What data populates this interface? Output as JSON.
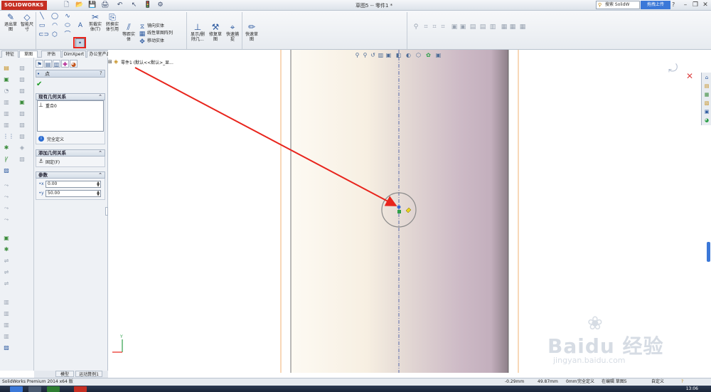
{
  "window": {
    "app_logo": "SOLIDWORKS",
    "doc_title": "草图5 -- 零件1 *",
    "search_label": "搜索 SolidW",
    "upload_label": "拖拽上传",
    "help_label": "?",
    "min_label": "–",
    "restore_label": "❐",
    "close_label": "✕"
  },
  "quick_access": [
    "🗋",
    "📂",
    "💾",
    "🖨",
    "↶",
    "↖",
    "🚦",
    "⚙"
  ],
  "command_manager": {
    "exit_sketch": "退出草\n图",
    "smart_dim": "智能尺\n寸",
    "trim": "剪裁实\n体(T)",
    "convert": "转换实\n体引用",
    "offset": "等距实\n体",
    "mirror": "镜向实体",
    "linear_pattern": "线性草图阵列",
    "move": "移动实体",
    "display_delete": "显示/删\n除几...",
    "repair": "修复草\n图",
    "quick_snap": "快速捕\n捉",
    "rapid_sketch": "快速草\n图"
  },
  "tabs": [
    "特征",
    "草图",
    "评估",
    "DimXpert",
    "办公室产品"
  ],
  "property_manager": {
    "title": "点",
    "help": "?",
    "existing_relations_header": "现有几何关系",
    "relation_item": "重合0",
    "fully_defined": "完全定义",
    "add_relations_header": "添加几何关系",
    "fix_label": "固定(F)",
    "params_header": "参数",
    "x_value": "0.00",
    "y_value": "50.00"
  },
  "feature_tree": {
    "root": "零件1 (默认<<默认>_显..."
  },
  "bottom_tabs": [
    "模型",
    "运动算例1"
  ],
  "status_bar": {
    "app_name": "SolidWorks Premium 2014 x64 版",
    "x": "-0.29mm",
    "y": "49.87mm",
    "z": "0mm",
    "state": "完全定义",
    "editing": "在编辑 草图5",
    "custom": "自定义"
  },
  "taskbar": {
    "clock": "13:06"
  },
  "watermark": {
    "main": "Baidu 经验",
    "sub": "jingyan.baidu.com"
  },
  "colors": {
    "annotation_red": "#e8241c",
    "cylinder_light": "#fbf7ef",
    "cylinder_dark": "#c8b6c4",
    "edge_orange": "#f0b070"
  }
}
